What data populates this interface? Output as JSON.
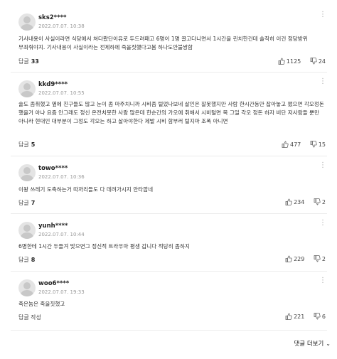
{
  "comments": [
    {
      "nickname": "sks2****",
      "date": "2022.07.07. 10:38",
      "more_icon": "more-icon",
      "text": "기사내용이 사실이라면 식당에서 쳐다봤단이유로 두드려패고 6명이 1명 끌고다니면서 1시간을 린치한건데 솔직히 이건 정당방위 무죄줘야지. 기사내용이 사실이라는 전제하에 죽을짓했다고봄 하나도안불쌍함",
      "reply_label": "답글",
      "reply_count": "33",
      "like_count": "1125",
      "dislike_count": "24"
    },
    {
      "nickname": "kkd9****",
      "date": "2022.07.07. 10:55",
      "more_icon": "more-icon",
      "text": "술도 좀취했고 옆에 친구들도 많고 눈이 좀 마주치니까 시비좀 털었나보네 살인은 잘못했지만 사람 한시간동안 잡아놓고 팼으면 각오정돈 했을거 아냐 요즘 안그래도 정신 온전치못한 사람 많은데 한순간의 가오에 취해서 시비털면 목 그일 각오 정돈 하자 비단 저사람들 뿐만 아니라 현대인 대부분이 그정도 각오는 하고 살아야한다 제발 시비 함부러 털지마 조폭 아니면",
      "reply_label": "답글",
      "reply_count": "5",
      "like_count": "477",
      "dislike_count": "15"
    },
    {
      "nickname": "towo****",
      "date": "2022.07.07. 10:36",
      "more_icon": "more-icon",
      "text": "이왕 쓰레기 도축하는거 따까리들도 다 데려가시지 안타깝네",
      "reply_label": "답글",
      "reply_count": "7",
      "like_count": "234",
      "dislike_count": "2"
    },
    {
      "nickname": "yunh****",
      "date": "2022.07.07. 10:44",
      "more_icon": "more-icon",
      "text": "6명한테 1시간 두들겨 맞으면그 정신적 트라우마 평생 갑니다 적당히 좀하지",
      "reply_label": "답글",
      "reply_count": "8",
      "like_count": "229",
      "dislike_count": "2"
    },
    {
      "nickname": "woo6****",
      "date": "2022.07.07. 19:33",
      "more_icon": "more-icon",
      "text": "죽은놈은 죽을짓했고",
      "reply_label": "답글 작성",
      "reply_count": "",
      "like_count": "221",
      "dislike_count": "6"
    }
  ],
  "more_comments_label": "댓글 더보기",
  "icons": {
    "like": "thumbs-up-icon",
    "dislike": "thumbs-down-icon",
    "more_comments": "chevron-down-icon"
  }
}
